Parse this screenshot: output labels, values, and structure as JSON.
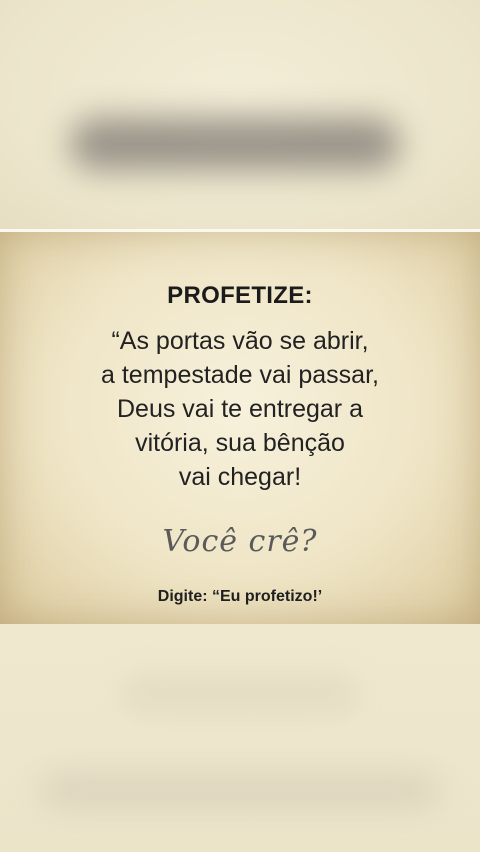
{
  "post": {
    "headline": "PROFETIZE:",
    "quote_lines": [
      "“As portas vão se abrir,",
      "a tempestade vai passar,",
      "Deus vai te entregar a",
      "vitória, sua bênção",
      "vai chegar!"
    ],
    "question": "Você crê?",
    "call_to_action": "Digite: “Eu profetizo!’"
  }
}
